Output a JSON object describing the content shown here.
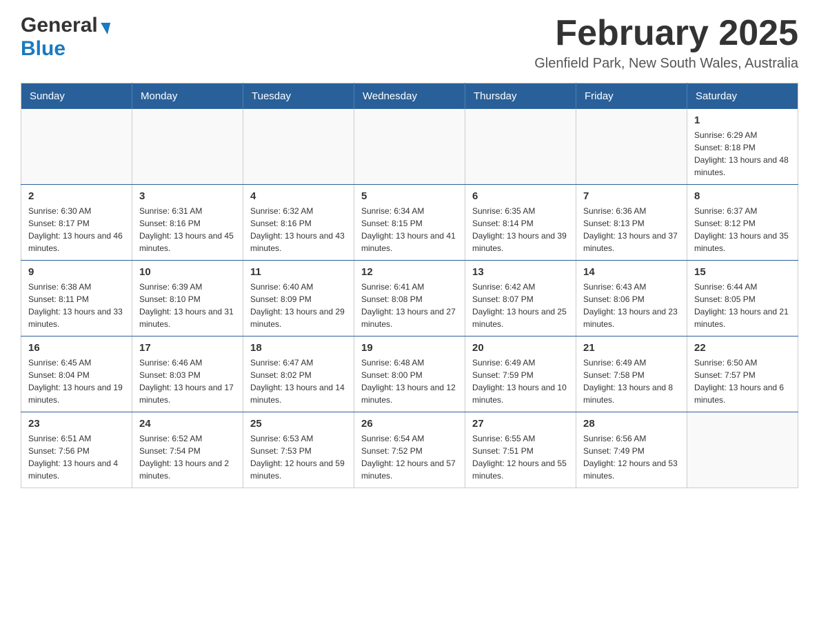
{
  "header": {
    "logo_general": "General",
    "logo_blue": "Blue",
    "month_title": "February 2025",
    "location": "Glenfield Park, New South Wales, Australia"
  },
  "days_of_week": [
    "Sunday",
    "Monday",
    "Tuesday",
    "Wednesday",
    "Thursday",
    "Friday",
    "Saturday"
  ],
  "weeks": [
    [
      {
        "day": "",
        "info": ""
      },
      {
        "day": "",
        "info": ""
      },
      {
        "day": "",
        "info": ""
      },
      {
        "day": "",
        "info": ""
      },
      {
        "day": "",
        "info": ""
      },
      {
        "day": "",
        "info": ""
      },
      {
        "day": "1",
        "info": "Sunrise: 6:29 AM\nSunset: 8:18 PM\nDaylight: 13 hours and 48 minutes."
      }
    ],
    [
      {
        "day": "2",
        "info": "Sunrise: 6:30 AM\nSunset: 8:17 PM\nDaylight: 13 hours and 46 minutes."
      },
      {
        "day": "3",
        "info": "Sunrise: 6:31 AM\nSunset: 8:16 PM\nDaylight: 13 hours and 45 minutes."
      },
      {
        "day": "4",
        "info": "Sunrise: 6:32 AM\nSunset: 8:16 PM\nDaylight: 13 hours and 43 minutes."
      },
      {
        "day": "5",
        "info": "Sunrise: 6:34 AM\nSunset: 8:15 PM\nDaylight: 13 hours and 41 minutes."
      },
      {
        "day": "6",
        "info": "Sunrise: 6:35 AM\nSunset: 8:14 PM\nDaylight: 13 hours and 39 minutes."
      },
      {
        "day": "7",
        "info": "Sunrise: 6:36 AM\nSunset: 8:13 PM\nDaylight: 13 hours and 37 minutes."
      },
      {
        "day": "8",
        "info": "Sunrise: 6:37 AM\nSunset: 8:12 PM\nDaylight: 13 hours and 35 minutes."
      }
    ],
    [
      {
        "day": "9",
        "info": "Sunrise: 6:38 AM\nSunset: 8:11 PM\nDaylight: 13 hours and 33 minutes."
      },
      {
        "day": "10",
        "info": "Sunrise: 6:39 AM\nSunset: 8:10 PM\nDaylight: 13 hours and 31 minutes."
      },
      {
        "day": "11",
        "info": "Sunrise: 6:40 AM\nSunset: 8:09 PM\nDaylight: 13 hours and 29 minutes."
      },
      {
        "day": "12",
        "info": "Sunrise: 6:41 AM\nSunset: 8:08 PM\nDaylight: 13 hours and 27 minutes."
      },
      {
        "day": "13",
        "info": "Sunrise: 6:42 AM\nSunset: 8:07 PM\nDaylight: 13 hours and 25 minutes."
      },
      {
        "day": "14",
        "info": "Sunrise: 6:43 AM\nSunset: 8:06 PM\nDaylight: 13 hours and 23 minutes."
      },
      {
        "day": "15",
        "info": "Sunrise: 6:44 AM\nSunset: 8:05 PM\nDaylight: 13 hours and 21 minutes."
      }
    ],
    [
      {
        "day": "16",
        "info": "Sunrise: 6:45 AM\nSunset: 8:04 PM\nDaylight: 13 hours and 19 minutes."
      },
      {
        "day": "17",
        "info": "Sunrise: 6:46 AM\nSunset: 8:03 PM\nDaylight: 13 hours and 17 minutes."
      },
      {
        "day": "18",
        "info": "Sunrise: 6:47 AM\nSunset: 8:02 PM\nDaylight: 13 hours and 14 minutes."
      },
      {
        "day": "19",
        "info": "Sunrise: 6:48 AM\nSunset: 8:00 PM\nDaylight: 13 hours and 12 minutes."
      },
      {
        "day": "20",
        "info": "Sunrise: 6:49 AM\nSunset: 7:59 PM\nDaylight: 13 hours and 10 minutes."
      },
      {
        "day": "21",
        "info": "Sunrise: 6:49 AM\nSunset: 7:58 PM\nDaylight: 13 hours and 8 minutes."
      },
      {
        "day": "22",
        "info": "Sunrise: 6:50 AM\nSunset: 7:57 PM\nDaylight: 13 hours and 6 minutes."
      }
    ],
    [
      {
        "day": "23",
        "info": "Sunrise: 6:51 AM\nSunset: 7:56 PM\nDaylight: 13 hours and 4 minutes."
      },
      {
        "day": "24",
        "info": "Sunrise: 6:52 AM\nSunset: 7:54 PM\nDaylight: 13 hours and 2 minutes."
      },
      {
        "day": "25",
        "info": "Sunrise: 6:53 AM\nSunset: 7:53 PM\nDaylight: 12 hours and 59 minutes."
      },
      {
        "day": "26",
        "info": "Sunrise: 6:54 AM\nSunset: 7:52 PM\nDaylight: 12 hours and 57 minutes."
      },
      {
        "day": "27",
        "info": "Sunrise: 6:55 AM\nSunset: 7:51 PM\nDaylight: 12 hours and 55 minutes."
      },
      {
        "day": "28",
        "info": "Sunrise: 6:56 AM\nSunset: 7:49 PM\nDaylight: 12 hours and 53 minutes."
      },
      {
        "day": "",
        "info": ""
      }
    ]
  ]
}
